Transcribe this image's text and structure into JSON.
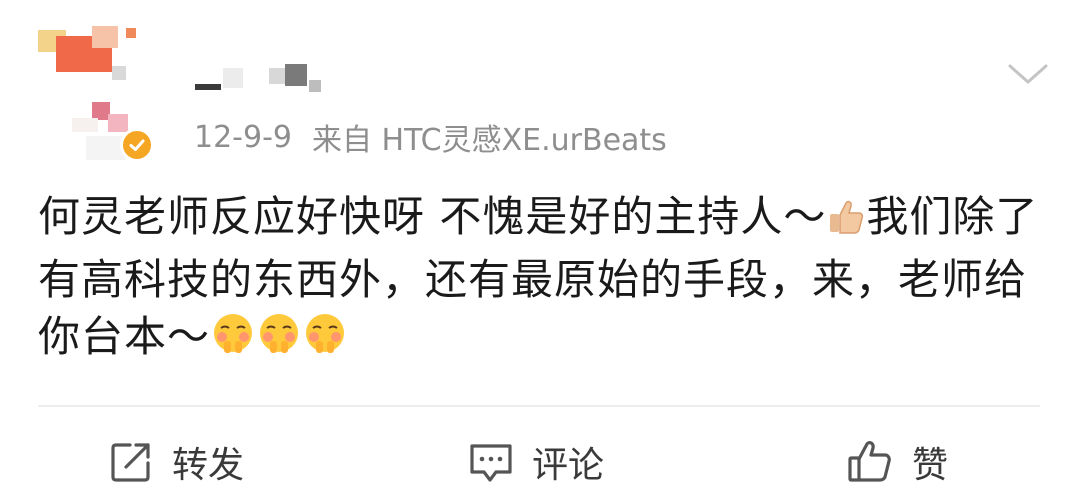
{
  "post": {
    "timestamp": "12-9-9",
    "source": "来自 HTC灵感XE.urBeats",
    "text_parts": [
      "何灵老师反应好快呀 不愧是好的主持人～",
      "我们除了有高科技的东西外，还有最原始的手段，来，老师给你台本～"
    ],
    "inline_icons": [
      "thumbs-up-emoji",
      "shy-face-emoji",
      "shy-face-emoji",
      "shy-face-emoji"
    ]
  },
  "actions": {
    "repost_label": "转发",
    "comment_label": "评论",
    "like_label": "赞"
  },
  "colors": {
    "verified_badge": "#f5a623",
    "meta_text": "#8e8e8e",
    "body_text": "#1a1a1a"
  }
}
